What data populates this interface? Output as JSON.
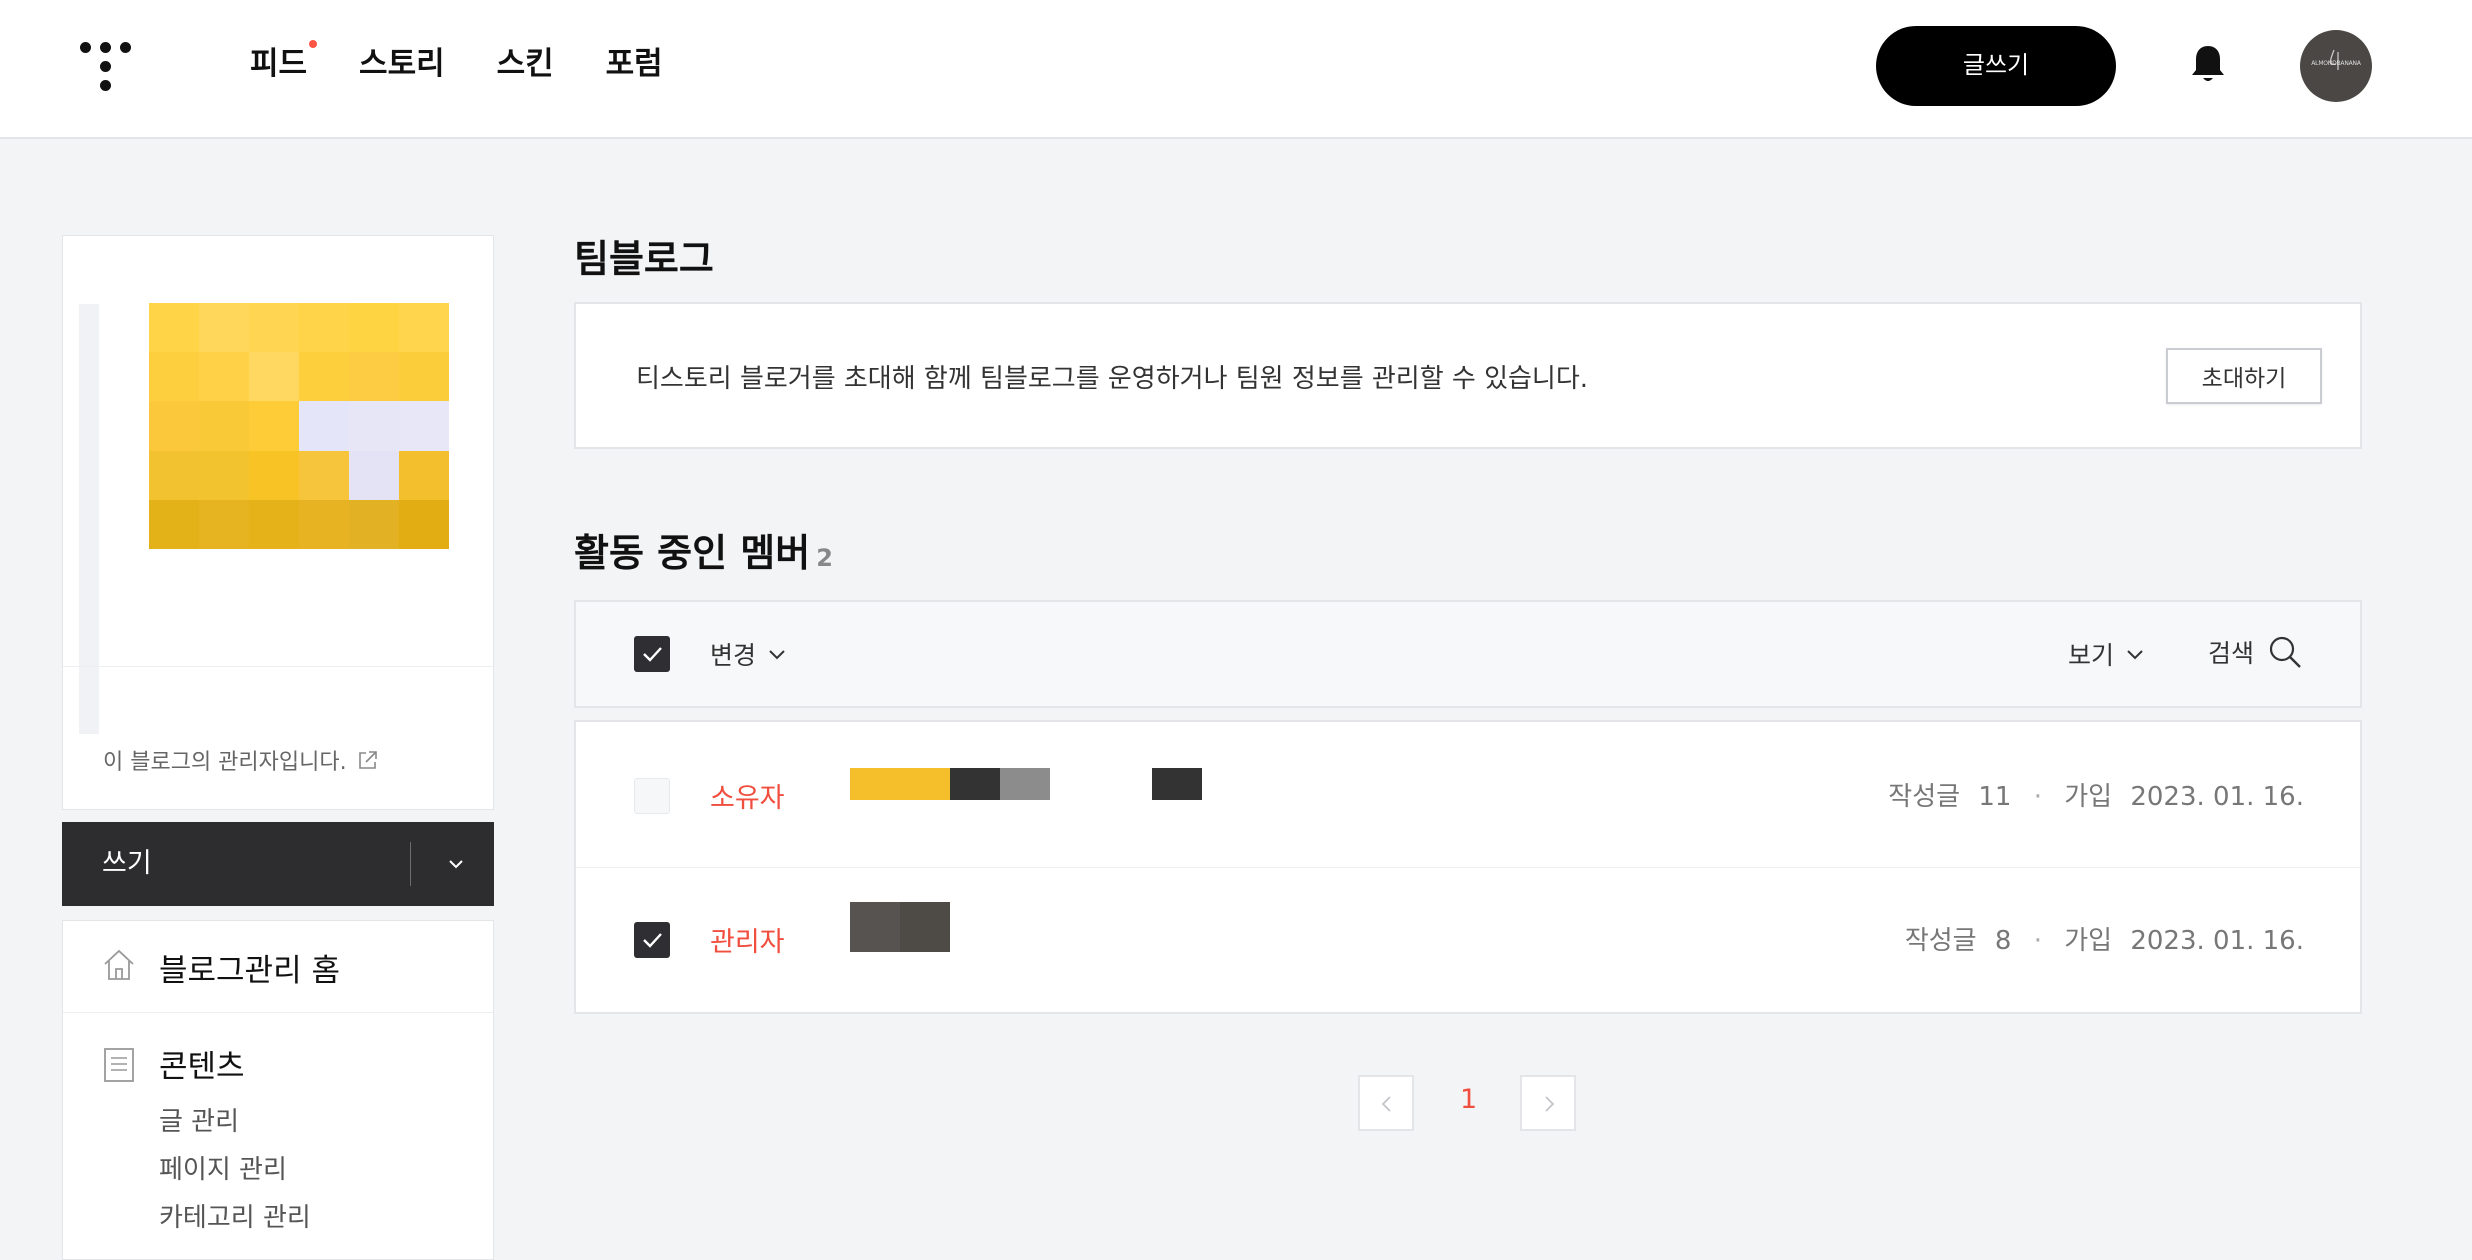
{
  "header": {
    "nav": [
      {
        "label": "피드",
        "has_dot": true
      },
      {
        "label": "스토리",
        "has_dot": false
      },
      {
        "label": "스킨",
        "has_dot": false
      },
      {
        "label": "포럼",
        "has_dot": false
      }
    ],
    "write_button": "글쓰기",
    "avatar_text": "ALMONDBANANA",
    "icons": [
      "tistory-logo-icon",
      "bell-icon"
    ]
  },
  "sidebar": {
    "admin_note": "이 블로그의 관리자입니다.",
    "write_label": "쓰기",
    "menu": {
      "home": "블로그관리 홈",
      "contents": "콘텐츠",
      "sub_items": [
        "글 관리",
        "페이지 관리",
        "카테고리 관리"
      ]
    }
  },
  "main": {
    "title": "팀블로그",
    "invite_desc": "티스토리 블로거를 초대해 함께 팀블로그를 운영하거나 팀원 정보를 관리할 수 있습니다.",
    "invite_button": "초대하기",
    "members_title": "활동 중인 멤버",
    "members_count": "2",
    "toolbar": {
      "change": "변경",
      "view": "보기",
      "search": "검색"
    },
    "members": [
      {
        "role": "소유자",
        "posts_label": "작성글",
        "posts": "11",
        "joined_label": "가입",
        "joined": "2023. 01. 16.",
        "checked": false
      },
      {
        "role": "관리자",
        "posts_label": "작성글",
        "posts": "8",
        "joined_label": "가입",
        "joined": "2023. 01. 16.",
        "checked": true
      }
    ],
    "pagination": {
      "current": "1"
    }
  },
  "colors": {
    "accent_red": "#f04e3e",
    "dark": "#2d2d2f",
    "page_bg": "#f3f4f6"
  }
}
